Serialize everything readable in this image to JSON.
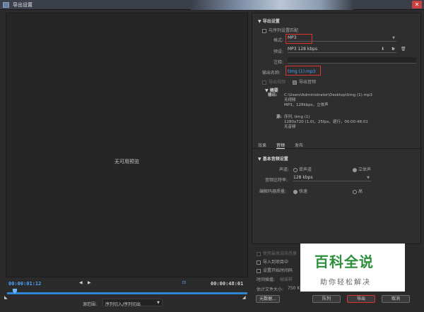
{
  "window": {
    "title": "导出设置"
  },
  "preview": {
    "message": "无可用预览"
  },
  "timeline": {
    "current_time": "00:00:01:12",
    "end_time": "00:00:48:01",
    "source_range_label": "源范围:",
    "source_range_value": "序列切入/序列切出"
  },
  "export_settings": {
    "section_title": "导出设置",
    "match_sequence_label": "与序列设置匹配",
    "format_label": "格式:",
    "format_value": "MP3",
    "preset_label": "预设:",
    "preset_value": "MP3 128 kbps",
    "comments_label": "注释:",
    "comments_value": "",
    "output_name_label": "输出名称:",
    "output_name_value": "timg (1).mp3",
    "export_video_label": "导出视频",
    "export_audio_label": "导出音频"
  },
  "summary": {
    "title": "摘要",
    "output_label": "输出:",
    "output_lines": [
      "C:\\Users\\Administrator\\Desktop\\timg (1).mp3",
      "无视频",
      "MP3，128kbps，立体声"
    ],
    "source_label": "源:",
    "source_lines": [
      "序列, timg (1)",
      "1280x720 (1.0)，25fps，逐行，00:00:48:01",
      "无音频"
    ]
  },
  "tabs": [
    "效果",
    "音频",
    "发布"
  ],
  "active_tab": "音频",
  "audio": {
    "section_title": "基本音频设置",
    "channels_label": "声道:",
    "mono_label": "单声道",
    "stereo_label": "立体声",
    "bitrate_label": "音频比特率:",
    "bitrate_value": "128 kbps",
    "quality_label": "编解码器质量:",
    "fast_label": "快速",
    "high_label": "高"
  },
  "bottom": {
    "max_render_label": "使用最高渲染质量",
    "import_project_label": "导入到项目中",
    "set_start_tc_label": "设置开始时间码",
    "time_interp_label": "时间插值:",
    "time_interp_value": "帧采样",
    "file_size_label": "估计文件大小:",
    "file_size_value": "750 KB",
    "metadata_button": "元数据...",
    "queue_button": "队列",
    "export_button": "导出",
    "cancel_button": "取消"
  },
  "watermark": {
    "title": "百科全说",
    "subtitle": "助你轻松解决"
  }
}
